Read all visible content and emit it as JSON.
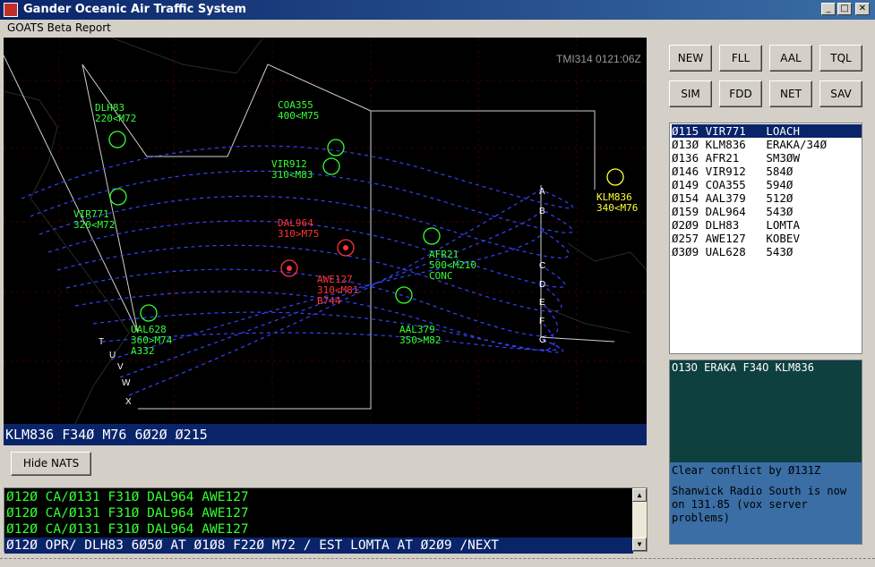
{
  "window": {
    "title": "Gander Oceanic Air Traffic System"
  },
  "menu": {
    "item": "GOATS Beta Report"
  },
  "radar": {
    "clock": "TMI314 0121:06Z",
    "entry_points_right": [
      "A",
      "B",
      "C",
      "D",
      "E",
      "F",
      "G"
    ],
    "entry_points_left": [
      "T",
      "U",
      "V",
      "W",
      "X"
    ],
    "aircraft": [
      {
        "callsign": "DLH83",
        "data": "220<M72",
        "color": "#33ff33"
      },
      {
        "callsign": "COA355",
        "data": "400<M75",
        "color": "#33ff33"
      },
      {
        "callsign": "VIR912",
        "data": "310<M83",
        "color": "#33ff33"
      },
      {
        "callsign": "VIR771",
        "data": "320<M72",
        "color": "#33ff33"
      },
      {
        "callsign": "DAL964",
        "data": "310>M75",
        "color": "#ff3333"
      },
      {
        "callsign": "AWE127",
        "data": "310<M81",
        "type": "B744",
        "color": "#ff3333"
      },
      {
        "callsign": "AFR21",
        "data": "500<M210",
        "extra": "CONC",
        "color": "#33ff33"
      },
      {
        "callsign": "UAL628",
        "data": "360>M74",
        "type": "A332",
        "color": "#33ff33"
      },
      {
        "callsign": "AAL379",
        "data": "350>M82",
        "color": "#33ff33"
      },
      {
        "callsign": "KLM836",
        "data": "340<M76",
        "color": "#ffff33"
      }
    ]
  },
  "selected_strip": "KLM836 F34Ø M76 6Ø2Ø Ø215",
  "hide_nats_label": "Hide NATS",
  "buttons": [
    "NEW",
    "FLL",
    "AAL",
    "TQL",
    "SIM",
    "FDD",
    "NET",
    "SAV"
  ],
  "flight_list": [
    {
      "time": "Ø115",
      "callsign": "VIR771",
      "point": "LOACH"
    },
    {
      "time": "Ø13Ø",
      "callsign": "KLM836",
      "point": "ERAKA/34Ø"
    },
    {
      "time": "Ø136",
      "callsign": "AFR21",
      "point": "SM3ØW"
    },
    {
      "time": "Ø146",
      "callsign": "VIR912",
      "point": "584Ø"
    },
    {
      "time": "Ø149",
      "callsign": "COA355",
      "point": "594Ø"
    },
    {
      "time": "Ø154",
      "callsign": "AAL379",
      "point": "512Ø"
    },
    {
      "time": "Ø159",
      "callsign": "DAL964",
      "point": "543Ø"
    },
    {
      "time": "Ø2Ø9",
      "callsign": "DLH83",
      "point": "LOMTA"
    },
    {
      "time": "Ø257",
      "callsign": "AWE127",
      "point": "KOBEV"
    },
    {
      "time": "Ø3Ø9",
      "callsign": "UAL628",
      "point": "543Ø"
    }
  ],
  "info_panel": {
    "header": "O13O ERAKA F34O KLM836",
    "line1": "Clear conflict by Ø131Z",
    "line2": "Shanwick Radio South is now on 131.85 (vox server problems)"
  },
  "messages": [
    "Ø12Ø CA/Ø131 F31Ø DAL964 AWE127",
    "Ø12Ø CA/Ø131 F31Ø DAL964 AWE127",
    "Ø12Ø CA/Ø131 F31Ø DAL964 AWE127",
    "Ø12Ø OPR/ DLH83 6Ø5Ø AT Ø1Ø8 F22Ø M72 / EST LOMTA AT Ø2Ø9 /NEXT"
  ],
  "colors": {
    "accent": "#0a246a",
    "track": "#3344ff",
    "radar_bg": "#000000",
    "conflict": "#ff3333",
    "ok": "#33ff33",
    "selected": "#ffff33"
  }
}
